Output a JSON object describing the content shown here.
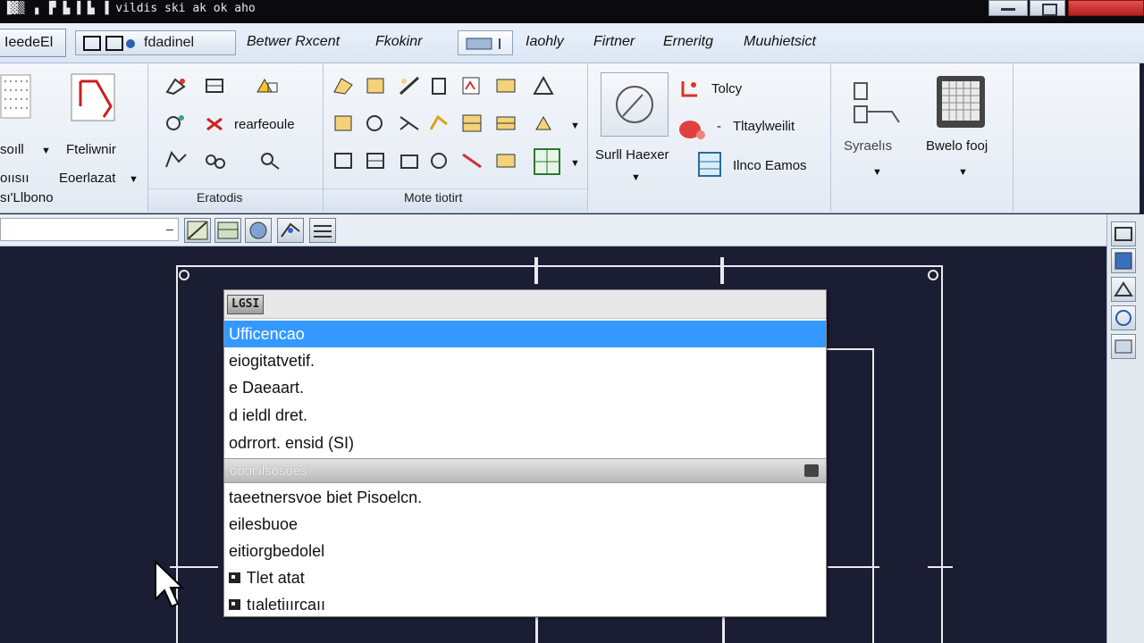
{
  "window": {
    "title": "▐▓▒ ▗ ▐▘▐▖▐ ▙ ▐  vildis ski ak ok aho",
    "colors": {
      "titlebar": "#0b0b0d",
      "close": "#c62828",
      "canvas": "#1b1d33",
      "selection": "#3399ff"
    }
  },
  "tabs": {
    "first": "IeedeEl",
    "qat_label": "fdadinel",
    "items": [
      "Betwer Rxcent",
      "Fkokinr",
      "Iaohly",
      "Firtner",
      "Erneritg",
      "Muuhietsict"
    ]
  },
  "ribbon": {
    "group1": {
      "label_a": "soıll",
      "label_b": "Fteliwnir",
      "label_c": "oıısıı",
      "label_d": "Eoerlazat",
      "label_e": "sı'Llbono"
    },
    "group2": {
      "label": "Eratodis",
      "text_a": "rearfeoule"
    },
    "group3": {
      "label": "Mote tiotirt"
    },
    "group4": {
      "big_label": "Surll Haexer",
      "item_a": "Tolcy",
      "item_b": "Tltaylweilit",
      "item_c": "Ilnco Eamos"
    },
    "group5": {
      "label_a": "Syraelıs",
      "label_b": "Bwelo fooj"
    }
  },
  "dropdown": {
    "header_tag": "LGSI",
    "items": [
      "Ufficencao",
      "eiogitatvetif.",
      "e  Daeaart.",
      "d ieldl dret.",
      "odrrort. ensid (SI)"
    ],
    "separator_text": "oooi ilsosoes",
    "items2": [
      "taeetnersvoe biet Pisoelcn.",
      "eilesbuoe",
      "eitiorgbedolel",
      "Tlet atat",
      "tıaletiıırcaıı"
    ],
    "item_icons": [
      "mark-icon",
      "mark-icon"
    ]
  }
}
